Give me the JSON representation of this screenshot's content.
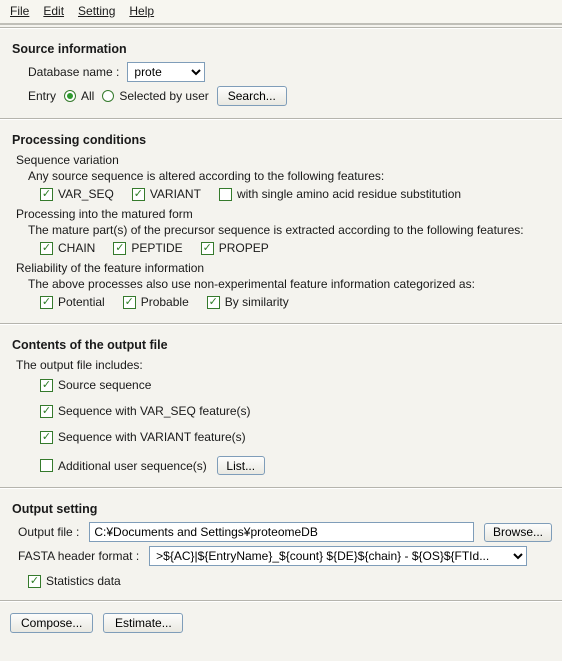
{
  "menu": {
    "file": "File",
    "edit": "Edit",
    "setting": "Setting",
    "help": "Help"
  },
  "source": {
    "title": "Source information",
    "db_label": "Database name :",
    "db_value": "prote",
    "entry_label": "Entry",
    "opt_all": "All",
    "opt_selected": "Selected by user",
    "search_btn": "Search..."
  },
  "proc": {
    "title": "Processing conditions",
    "seqvar_title": "Sequence variation",
    "seqvar_desc": "Any source sequence is altered according to the following features:",
    "cb_varseq": "VAR_SEQ",
    "cb_variant": "VARIANT",
    "cb_subst": "with single amino acid residue substitution",
    "mature_title": "Processing into the matured form",
    "mature_desc": "The mature part(s) of the precursor sequence is extracted according to the following features:",
    "cb_chain": "CHAIN",
    "cb_peptide": "PEPTIDE",
    "cb_propep": "PROPEP",
    "rel_title": "Reliability of the feature information",
    "rel_desc": "The above processes also use non-experimental feature information categorized as:",
    "cb_potential": "Potential",
    "cb_probable": "Probable",
    "cb_similarity": "By similarity"
  },
  "contents": {
    "title": "Contents of the output file",
    "desc": "The output file includes:",
    "cb_src": "Source sequence",
    "cb_varseq": "Sequence with VAR_SEQ feature(s)",
    "cb_variant": "Sequence with VARIANT feature(s)",
    "cb_user": "Additional user sequence(s)",
    "list_btn": "List..."
  },
  "output": {
    "title": "Output setting",
    "file_label": "Output file :",
    "file_value": "C:¥Documents and Settings¥proteomeDB",
    "browse_btn": "Browse...",
    "fasta_label": "FASTA header format :",
    "fasta_value": ">${AC}|${EntryName}_${count} ${DE}${chain} - ${OS}${FTId...",
    "cb_stats": "Statistics data"
  },
  "footer": {
    "compose": "Compose...",
    "estimate": "Estimate..."
  }
}
